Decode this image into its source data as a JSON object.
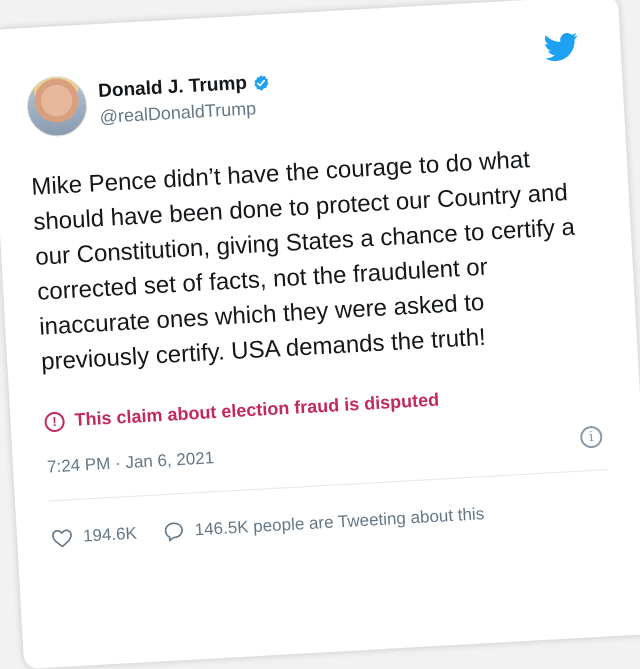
{
  "user": {
    "display_name": "Donald J. Trump",
    "handle": "@realDonaldTrump",
    "verified": true
  },
  "tweet": {
    "text": "Mike Pence didn’t have the courage to do what should have been done to protect our Country and our Constitution, giving States a chance to certify a corrected set of facts, not the fraudulent or inaccurate ones which they were asked to previously certify. USA demands the truth!",
    "disputed_label": "This claim about election fraud is disputed",
    "timestamp": "7:24 PM · Jan 6, 2021"
  },
  "stats": {
    "likes": "194.6K",
    "tweeting": "146.5K people are Tweeting about this"
  },
  "icons": {
    "brand": "twitter-bird-icon",
    "verified": "verified-badge-icon",
    "disputed": "exclamation-circle-icon",
    "info": "info-icon",
    "like": "heart-icon",
    "reply": "speech-bubble-icon"
  },
  "colors": {
    "twitter_blue": "#1da1f2",
    "disputed": "#c3285e",
    "text": "#14171a",
    "muted": "#657786"
  }
}
